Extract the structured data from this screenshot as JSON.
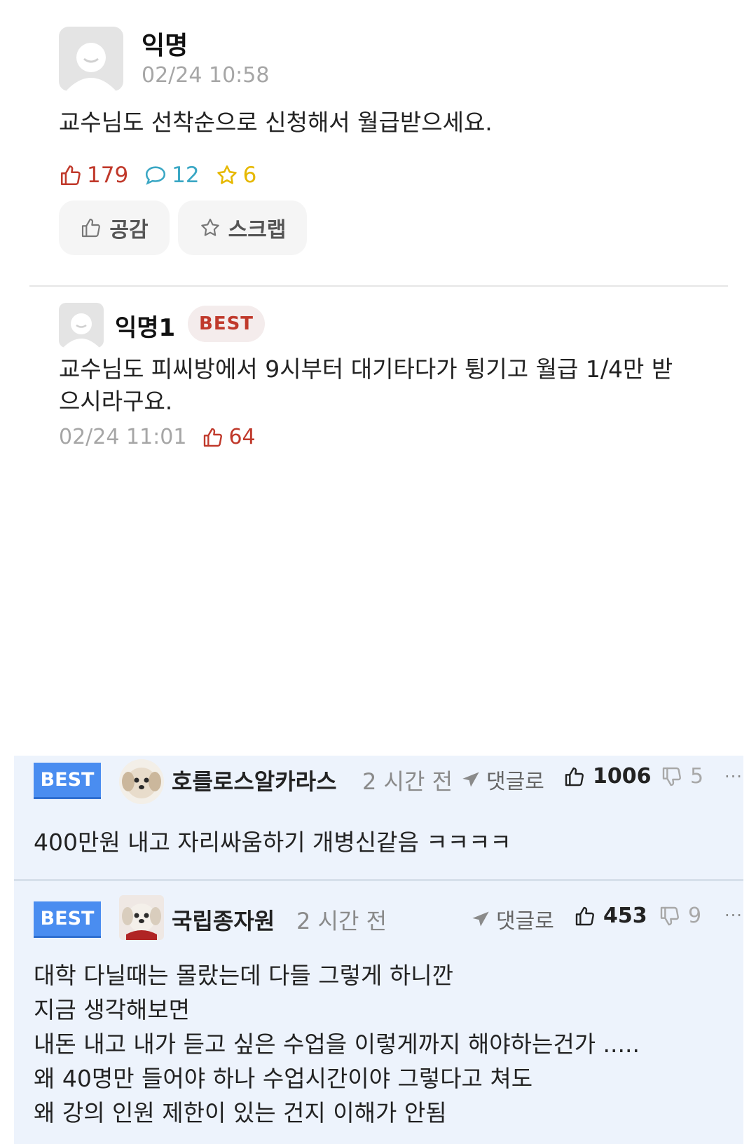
{
  "post": {
    "author": "익명",
    "date": "02/24 10:58",
    "body": "교수님도 선착순으로 신청해서 월급받으세요.",
    "likes": "179",
    "comments": "12",
    "scraps": "6",
    "like_button": "공감",
    "scrap_button": "스크랩"
  },
  "best_comment": {
    "author": "익명1",
    "badge": "BEST",
    "body": "교수님도 피씨방에서 9시부터 대기타다가 튕기고 월급 1/4만 받으시라구요.",
    "date": "02/24 11:01",
    "likes": "64"
  },
  "board_comments": [
    {
      "badge": "BEST",
      "author": "호를로스알카라스",
      "time": "2 시간 전",
      "reply_label": "댓글로",
      "upvotes": "1006",
      "downvotes": "5",
      "more": "···",
      "lines": [
        "400만원 내고 자리싸움하기 개병신같음 ㅋㅋㅋㅋ"
      ]
    },
    {
      "badge": "BEST",
      "author": "국립종자원",
      "time": "2 시간 전",
      "reply_label": "댓글로",
      "upvotes": "453",
      "downvotes": "9",
      "more": "···",
      "lines": [
        "대학 다닐때는 몰랐는데 다들 그렇게 하니깐",
        "지금 생각해보면",
        "내돈 내고 내가 듣고 싶은 수업을 이렇게까지 해야하는건가 .....",
        "왜 40명만 들어야 하나 수업시간이야 그렇다고 쳐도",
        "왜 강의 인원 제한이 있는 건지 이해가 안됨"
      ]
    }
  ],
  "colors": {
    "like_red": "#c0392b",
    "comment_teal": "#3aa7c4",
    "scrap_yellow": "#e6b800",
    "best_blue": "#4a8df0",
    "board_bg": "#edf3fc"
  },
  "icons": [
    "avatar-placeholder-icon",
    "thumbs-up-icon",
    "speech-bubble-icon",
    "star-icon",
    "reply-arrow-icon",
    "thumbs-down-icon",
    "dog-avatar"
  ]
}
